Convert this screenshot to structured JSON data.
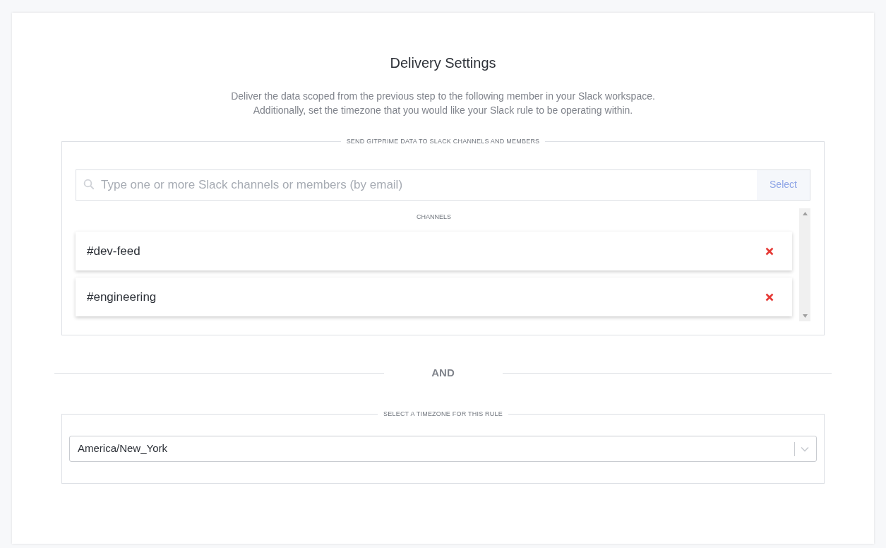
{
  "title": "Delivery Settings",
  "description": [
    "Deliver the data scoped from the previous step to the following member in your Slack workspace.",
    "Additionally, set the timezone that you would like your Slack rule to be operating within."
  ],
  "recipients": {
    "legend": "SEND GITPRIME DATA TO SLACK CHANNELS AND MEMBERS",
    "search": {
      "placeholder": "Type one or more Slack channels or members (by email)"
    },
    "select_button": "Select",
    "list_heading": "CHANNELS",
    "channels": [
      {
        "name": "#dev-feed"
      },
      {
        "name": "#engineering"
      }
    ]
  },
  "separator": "AND",
  "timezone": {
    "legend": "SELECT A TIMEZONE FOR THIS RULE",
    "value": "America/New_York"
  }
}
